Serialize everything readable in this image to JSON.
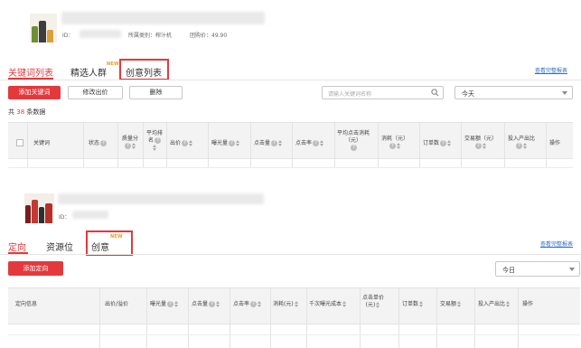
{
  "section1": {
    "product": {
      "id_label": "ID：",
      "category_label": "所属类别：榨汁机",
      "price_label": "团购价：49.90"
    },
    "tabs": [
      {
        "label": "关键词列表",
        "active": true
      },
      {
        "label": "精选人群",
        "badge": "NEW"
      },
      {
        "label": "创意列表"
      }
    ],
    "report_link": "查看完整报表",
    "toolbar": {
      "add_label": "添加关键词",
      "modify_bid_label": "修改出价",
      "delete_label": "删除",
      "search_placeholder": "请输入关键词名称",
      "date_value": "今天"
    },
    "count": {
      "prefix": "共 ",
      "value": "38",
      "suffix": " 条数据"
    },
    "columns": {
      "keyword": "关键词",
      "status": "状态",
      "quality_1": "质量分",
      "avg_rank_1": "平均排",
      "avg_rank_2": "名",
      "bid": "出价",
      "impressions": "曝光量",
      "clicks": "点击量",
      "ctr": "点击率",
      "avg_cpc_1": "平均点击消耗",
      "avg_cpc_2": "（元）",
      "spend": "消耗（元）",
      "orders": "订单数",
      "gmv": "交易额（元）",
      "roi": "投入产出比",
      "ops": "操作"
    }
  },
  "section2": {
    "product": {
      "id_label": "ID："
    },
    "tabs": [
      {
        "label": "定向",
        "active": true
      },
      {
        "label": "资源位"
      },
      {
        "label": "创意",
        "badge": "NEW"
      }
    ],
    "report_link": "查看完整报表",
    "toolbar": {
      "add_label": "添加定向",
      "date_value": "今日"
    },
    "columns": {
      "targeting": "定向信息",
      "bid": "出价/溢价",
      "impressions": "曝光量",
      "clicks": "点击量",
      "ctr": "点击率",
      "spend": "消耗(元)",
      "cpm": "千次曝光成本",
      "cpc_1": "点击单价",
      "cpc_2": "(元)",
      "orders": "订单数",
      "gmv": "交易额",
      "roi": "投入产出比",
      "ops": "操作"
    }
  },
  "colors": {
    "accent": "#e4393c",
    "link": "#2a6ec8",
    "badge": "#e89b27"
  }
}
